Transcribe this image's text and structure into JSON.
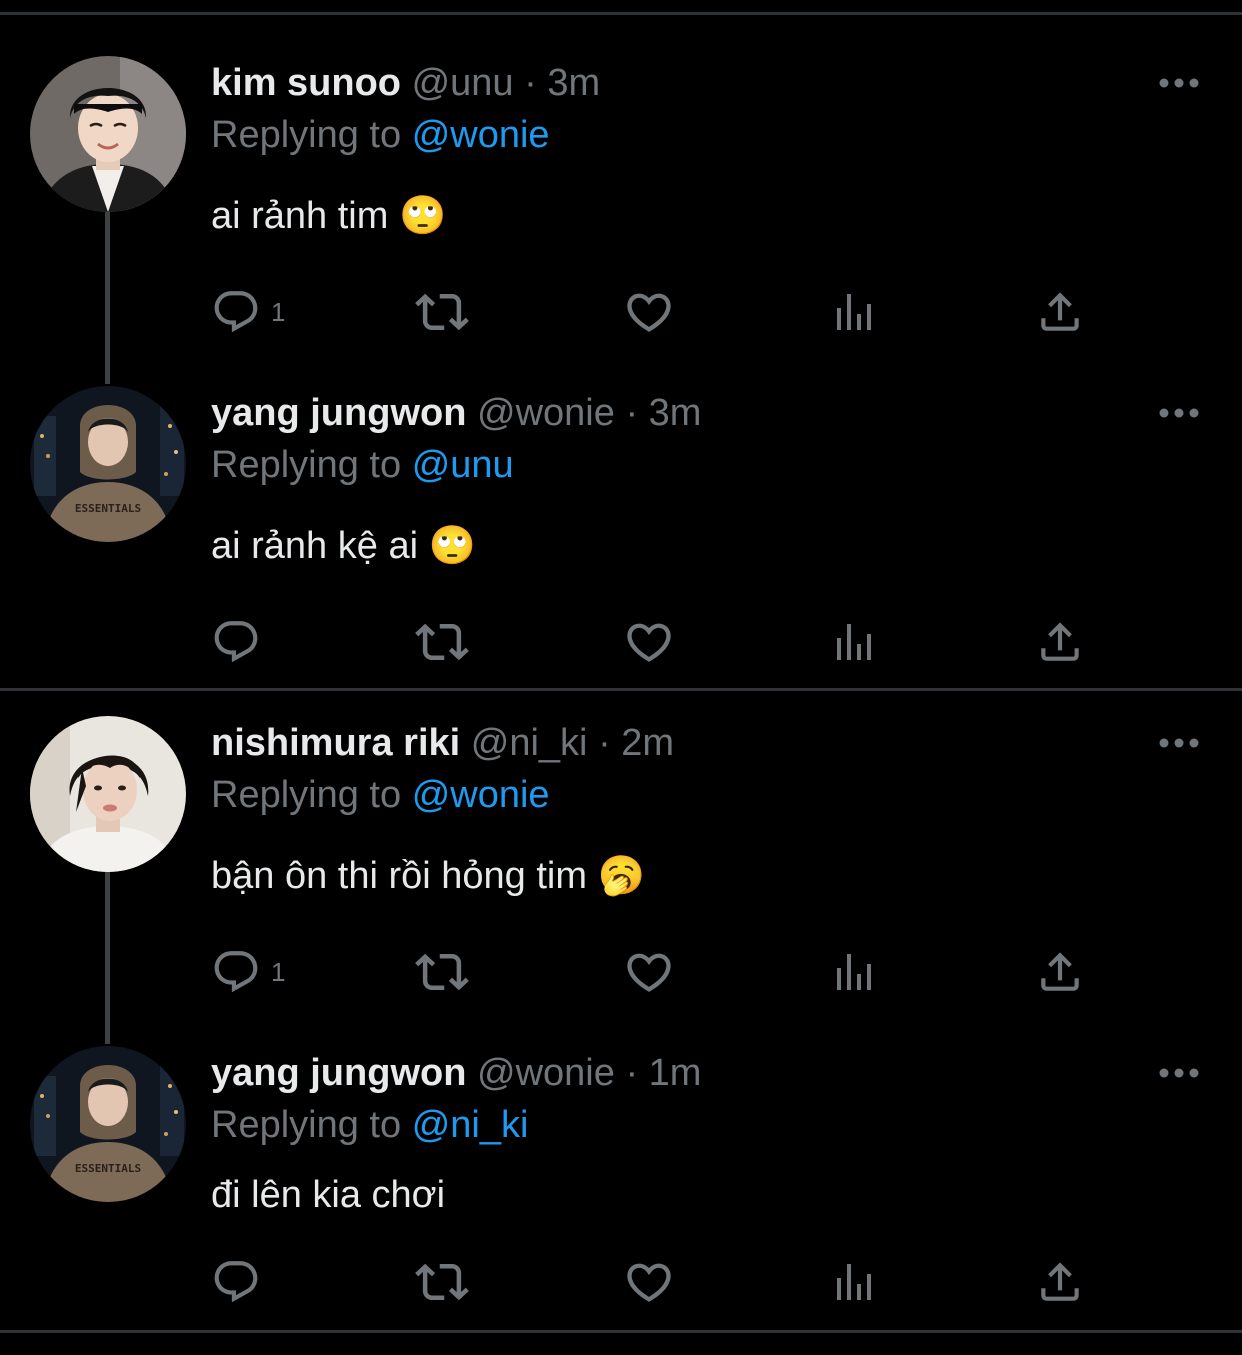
{
  "colors": {
    "background": "#000000",
    "divider": "#2f3336",
    "primary_text": "#e7e9ea",
    "secondary_text": "#71767b",
    "accent": "#1d9bf0",
    "thread_line": "#3e4144"
  },
  "tweets": [
    {
      "name": "kim sunoo",
      "handle": "@unu",
      "separator": "·",
      "time": "3m",
      "reply_label": "Replying to",
      "reply_to": "@wonie",
      "text": "ai rảnh tim 🙄",
      "reply_count": "1",
      "avatar_icon": "profile-photo-sunoo"
    },
    {
      "name": "yang jungwon",
      "handle": "@wonie",
      "separator": "·",
      "time": "3m",
      "reply_label": "Replying to",
      "reply_to": "@unu",
      "text": "ai rảnh kệ ai 🙄",
      "reply_count": "",
      "avatar_icon": "profile-photo-jungwon"
    },
    {
      "name": "nishimura riki",
      "handle": "@ni_ki",
      "separator": "·",
      "time": "2m",
      "reply_label": "Replying to",
      "reply_to": "@wonie",
      "text": "bận ôn thi rồi hỏng tim 🥱",
      "reply_count": "1",
      "avatar_icon": "profile-photo-riki"
    },
    {
      "name": "yang jungwon",
      "handle": "@wonie",
      "separator": "·",
      "time": "1m",
      "reply_label": "Replying to",
      "reply_to": "@ni_ki",
      "text": "đi lên kia chơi",
      "reply_count": "",
      "avatar_icon": "profile-photo-jungwon"
    }
  ],
  "action_icons": [
    "reply-icon",
    "retweet-icon",
    "like-icon",
    "analytics-icon",
    "share-icon"
  ],
  "avatar_logo_text": "ESSENTIALS"
}
